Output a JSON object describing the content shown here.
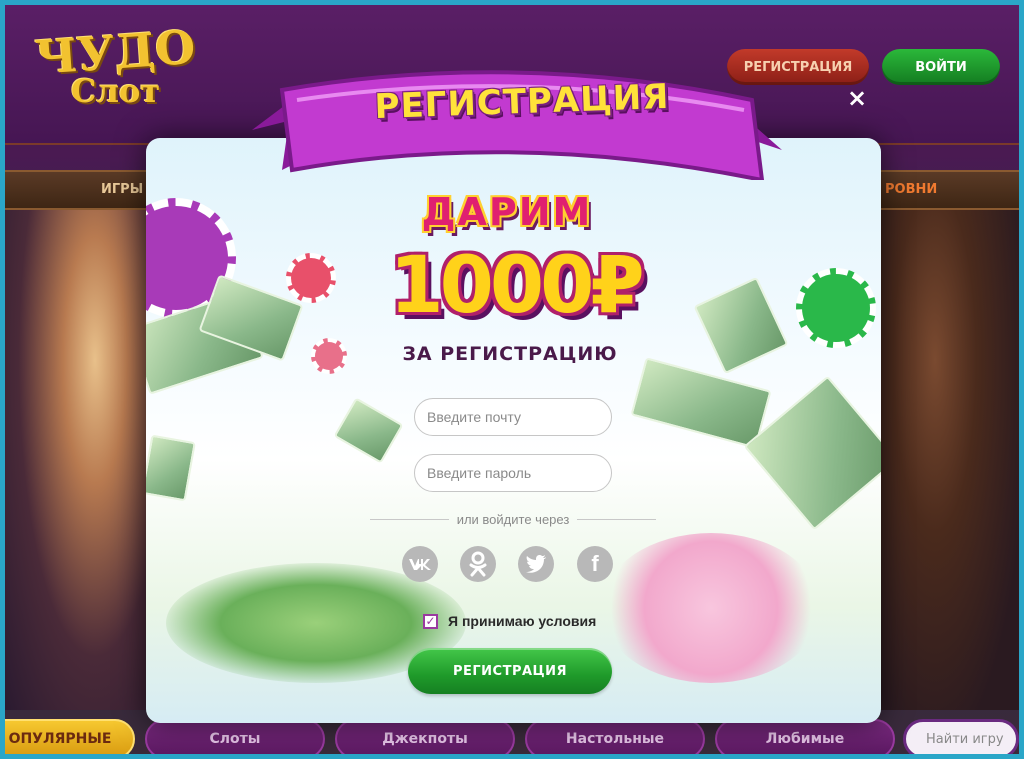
{
  "site": {
    "logo_line1": "ЧУДО",
    "logo_line2": "Слот",
    "header_register": "РЕГИСТРАЦИЯ",
    "header_login": "ВОЙТИ",
    "nav_games": "ИГРЫ",
    "nav_right": "РОВНИ",
    "bottom_tabs": [
      {
        "label": "ОПУЛЯРНЫЕ",
        "active": true
      },
      {
        "label": "Слоты",
        "active": false
      },
      {
        "label": "Джекпоты",
        "active": false
      },
      {
        "label": "Настольные",
        "active": false
      },
      {
        "label": "Любимые",
        "active": false
      }
    ],
    "search_placeholder": "Найти игру"
  },
  "modal": {
    "title": "РЕГИСТРАЦИЯ",
    "promo_top": "ДАРИМ",
    "promo_amount": "1000₽",
    "promo_bottom": "ЗА РЕГИСТРАЦИЮ",
    "email_placeholder": "Введите почту",
    "password_placeholder": "Введите пароль",
    "divider_text": "или войдите через",
    "social": {
      "vk": "VK",
      "ok": "OK",
      "twitter": "Twitter",
      "facebook": "f"
    },
    "terms_label": "Я принимаю условия",
    "terms_checked": true,
    "submit_label": "РЕГИСТРАЦИЯ",
    "close_symbol": "×"
  },
  "colors": {
    "frame": "#2aa6c8",
    "ribbon": "#c23ad0",
    "title_text": "#ffe23a",
    "submit": "#1f9a2a",
    "checkbox": "#9a3aa0"
  }
}
